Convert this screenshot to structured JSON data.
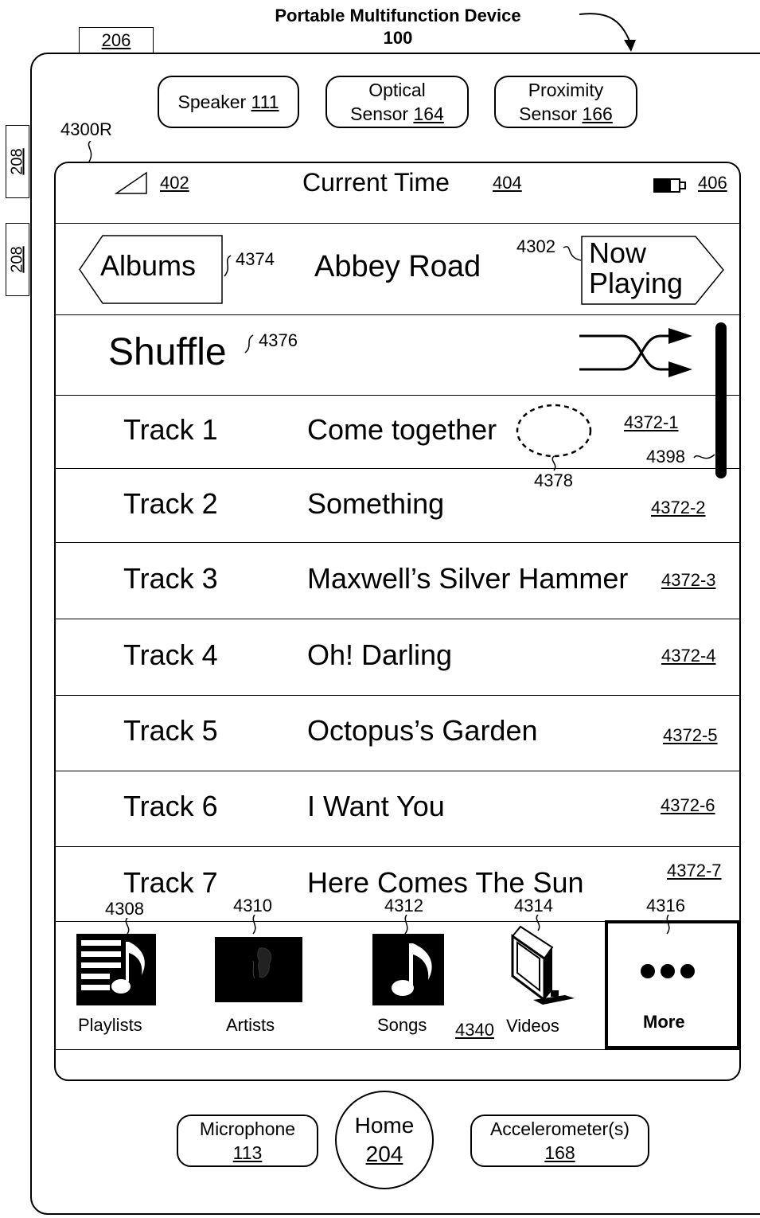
{
  "device": {
    "title_line1": "Portable Multifunction Device",
    "title_line2": "100",
    "tab_ref": "206",
    "side_button_top": "208",
    "side_button_bottom": "208",
    "screen_ref": "4300R"
  },
  "top_sensors": [
    {
      "label": "Speaker",
      "ref": "111"
    },
    {
      "label_line1": "Optical",
      "label_line2": "Sensor",
      "ref": "164"
    },
    {
      "label_line1": "Proximity",
      "label_line2": "Sensor",
      "ref": "166"
    }
  ],
  "status_bar": {
    "signal_ref": "402",
    "time_label": "Current Time",
    "time_ref": "404",
    "battery_ref": "406"
  },
  "nav": {
    "back_label": "Albums",
    "back_ref": "4374",
    "title": "Abbey Road",
    "forward_ref": "4302",
    "forward_line1": "Now",
    "forward_line2": "Playing"
  },
  "shuffle": {
    "label": "Shuffle",
    "ref": "4376"
  },
  "tracks": [
    {
      "label": "Track 1",
      "title": "Come together",
      "ref": "4372-1"
    },
    {
      "label": "Track 2",
      "title": "Something",
      "ref": "4372-2"
    },
    {
      "label": "Track 3",
      "title": "Maxwell’s Silver Hammer",
      "ref": "4372-3"
    },
    {
      "label": "Track 4",
      "title": "Oh! Darling",
      "ref": "4372-4"
    },
    {
      "label": "Track 5",
      "title": "Octopus’s Garden",
      "ref": "4372-5"
    },
    {
      "label": "Track 6",
      "title": "I Want You",
      "ref": "4372-6"
    },
    {
      "label": "Track 7",
      "title": "Here Comes The Sun",
      "ref": "4372-7"
    }
  ],
  "annotations": {
    "contact_ref": "4378",
    "scrollbar_ref": "4398",
    "tabbar_ref": "4340"
  },
  "tab_bar": [
    {
      "label": "Playlists",
      "ref": "4308",
      "icon": "playlists-icon"
    },
    {
      "label": "Artists",
      "ref": "4310",
      "icon": "artists-icon"
    },
    {
      "label": "Songs",
      "ref": "4312",
      "icon": "songs-icon"
    },
    {
      "label": "Videos",
      "ref": "4314",
      "icon": "videos-icon"
    },
    {
      "label": "More",
      "ref": "4316",
      "icon": "more-icon"
    }
  ],
  "bottom_hardware": {
    "microphone_label": "Microphone",
    "microphone_ref": "113",
    "home_label": "Home",
    "home_ref": "204",
    "accel_label": "Accelerometer(s)",
    "accel_ref": "168"
  }
}
